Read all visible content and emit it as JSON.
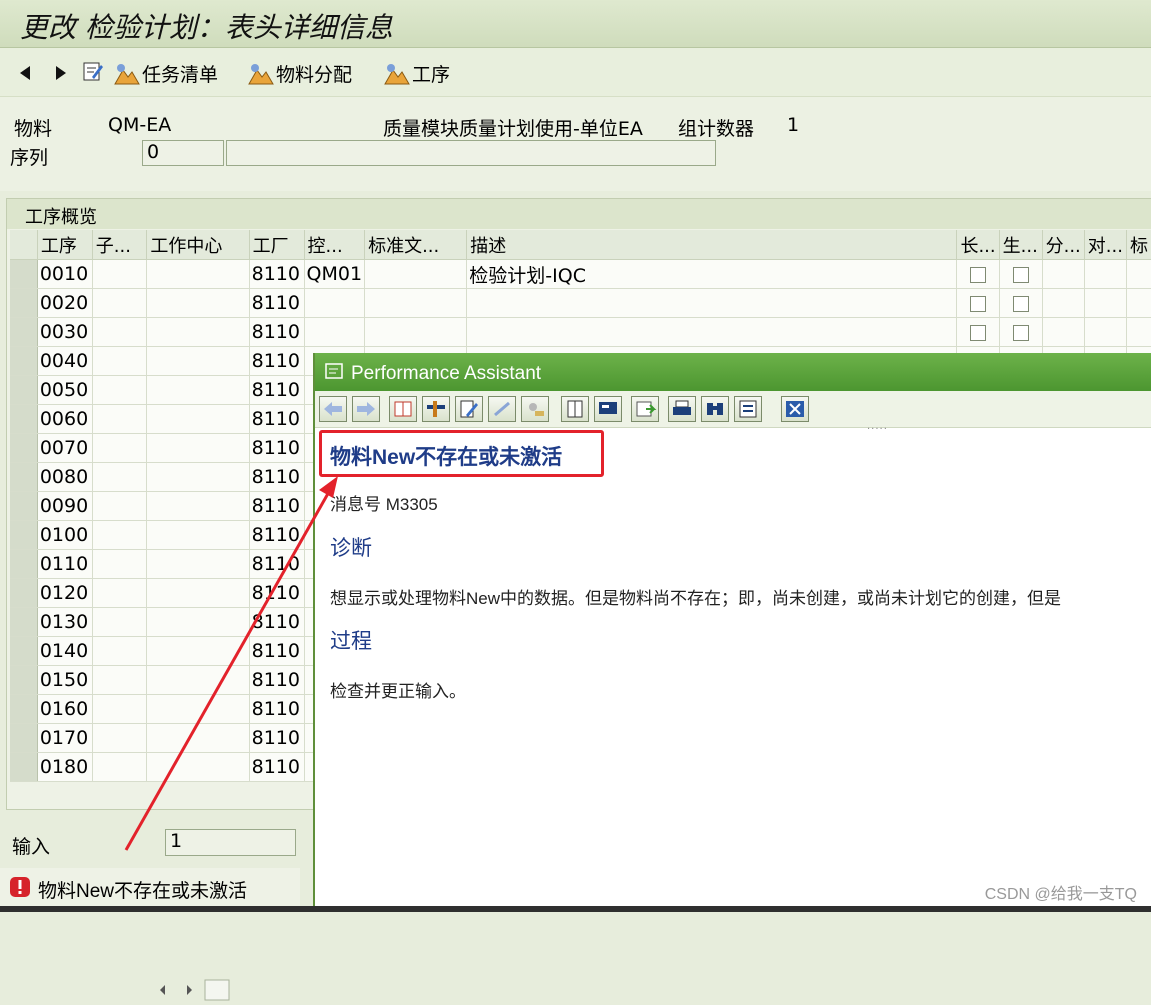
{
  "window_title": "更改 检验计划：表头详细信息",
  "toolbar": {
    "task_list": "任务清单",
    "material_assignment": "物料分配",
    "operations": "工序"
  },
  "header": {
    "material_label": "物料",
    "material_value": "QM-EA",
    "material_desc": "质量模块质量计划使用-单位EA",
    "group_counter_label": "组计数器",
    "group_counter_value": "1",
    "sequence_label": "序列",
    "sequence_value": "0",
    "sequence_text": ""
  },
  "overview": {
    "title": "工序概览",
    "columns": [
      "工序",
      "子...",
      "工作中心",
      "工厂",
      "控...",
      "标准文...",
      "描述",
      "长...",
      "生...",
      "分...",
      "对...",
      "标"
    ],
    "rows": [
      {
        "op": "0010",
        "plant": "8110",
        "ctrl": "QM01",
        "desc": "检验计划-IQC"
      },
      {
        "op": "0020",
        "plant": "8110",
        "ctrl": "",
        "desc": ""
      },
      {
        "op": "0030",
        "plant": "8110",
        "ctrl": "",
        "desc": ""
      },
      {
        "op": "0040",
        "plant": "8110",
        "ctrl": "",
        "desc": ""
      },
      {
        "op": "0050",
        "plant": "8110",
        "ctrl": "",
        "desc": ""
      },
      {
        "op": "0060",
        "plant": "8110",
        "ctrl": "",
        "desc": ""
      },
      {
        "op": "0070",
        "plant": "8110",
        "ctrl": "",
        "desc": ""
      },
      {
        "op": "0080",
        "plant": "8110",
        "ctrl": "",
        "desc": ""
      },
      {
        "op": "0090",
        "plant": "8110",
        "ctrl": "",
        "desc": ""
      },
      {
        "op": "0100",
        "plant": "8110",
        "ctrl": "",
        "desc": ""
      },
      {
        "op": "0110",
        "plant": "8110",
        "ctrl": "",
        "desc": ""
      },
      {
        "op": "0120",
        "plant": "8110",
        "ctrl": "",
        "desc": ""
      },
      {
        "op": "0130",
        "plant": "8110",
        "ctrl": "",
        "desc": ""
      },
      {
        "op": "0140",
        "plant": "8110",
        "ctrl": "",
        "desc": ""
      },
      {
        "op": "0150",
        "plant": "8110",
        "ctrl": "",
        "desc": ""
      },
      {
        "op": "0160",
        "plant": "8110",
        "ctrl": "",
        "desc": ""
      },
      {
        "op": "0170",
        "plant": "8110",
        "ctrl": "",
        "desc": ""
      },
      {
        "op": "0180",
        "plant": "8110",
        "ctrl": "",
        "desc": ""
      }
    ]
  },
  "entry": {
    "label": "输入",
    "value": "1"
  },
  "status_message": "物料New不存在或未激活",
  "assistant": {
    "title": "Performance Assistant",
    "message_title": "物料New不存在或未激活",
    "message_number": "消息号 M3305",
    "diagnosis_heading": "诊断",
    "diagnosis_text": "想显示或处理物料New中的数据。但是物料尚不存在；即，尚未创建，或尚未计划它的创建，但是",
    "procedure_heading": "过程",
    "procedure_text": "检查并更正输入。"
  },
  "watermark": "CSDN @给我一支TQ",
  "colors": {
    "accent_green": "#4c9630",
    "heading_blue": "#1f3c88",
    "highlight_red": "#e3222b"
  }
}
